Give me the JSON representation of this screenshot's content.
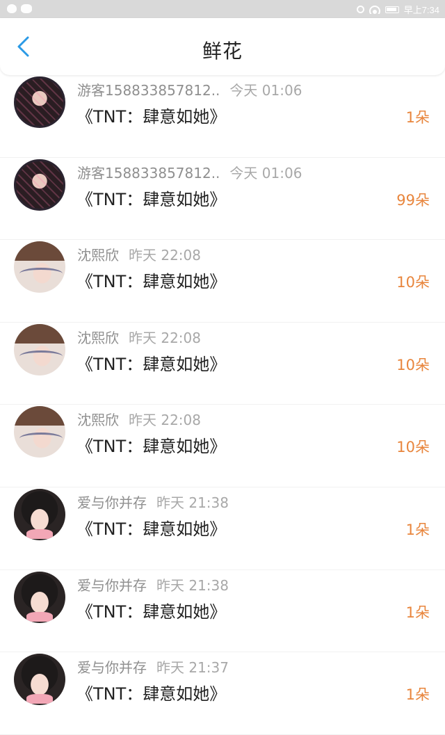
{
  "status_bar": {
    "time": "早上7:34"
  },
  "header": {
    "title": "鲜花"
  },
  "items": [
    {
      "name": "游客158833857812..",
      "time": "今天 01:06",
      "book": "《TNT：肆意如她》",
      "count": "1朵",
      "avatar": "avatar-glam"
    },
    {
      "name": "游客158833857812..",
      "time": "今天 01:06",
      "book": "《TNT：肆意如她》",
      "count": "99朵",
      "avatar": "avatar-glam"
    },
    {
      "name": "沈熙欣",
      "time": "昨天 22:08",
      "book": "《TNT：肆意如她》",
      "count": "10朵",
      "avatar": "avatar-bangs"
    },
    {
      "name": "沈熙欣",
      "time": "昨天 22:08",
      "book": "《TNT：肆意如她》",
      "count": "10朵",
      "avatar": "avatar-bangs"
    },
    {
      "name": "沈熙欣",
      "time": "昨天 22:08",
      "book": "《TNT：肆意如她》",
      "count": "10朵",
      "avatar": "avatar-bangs"
    },
    {
      "name": "爱与你并存",
      "time": "昨天 21:38",
      "book": "《TNT：肆意如她》",
      "count": "1朵",
      "avatar": "avatar-kid"
    },
    {
      "name": "爱与你并存",
      "time": "昨天 21:38",
      "book": "《TNT：肆意如她》",
      "count": "1朵",
      "avatar": "avatar-kid"
    },
    {
      "name": "爱与你并存",
      "time": "昨天 21:37",
      "book": "《TNT：肆意如她》",
      "count": "1朵",
      "avatar": "avatar-kid"
    }
  ],
  "colors": {
    "accent_blue": "#2b9ae6",
    "count_orange": "#e8853c",
    "status_bar_bg": "#d9d9d9"
  }
}
